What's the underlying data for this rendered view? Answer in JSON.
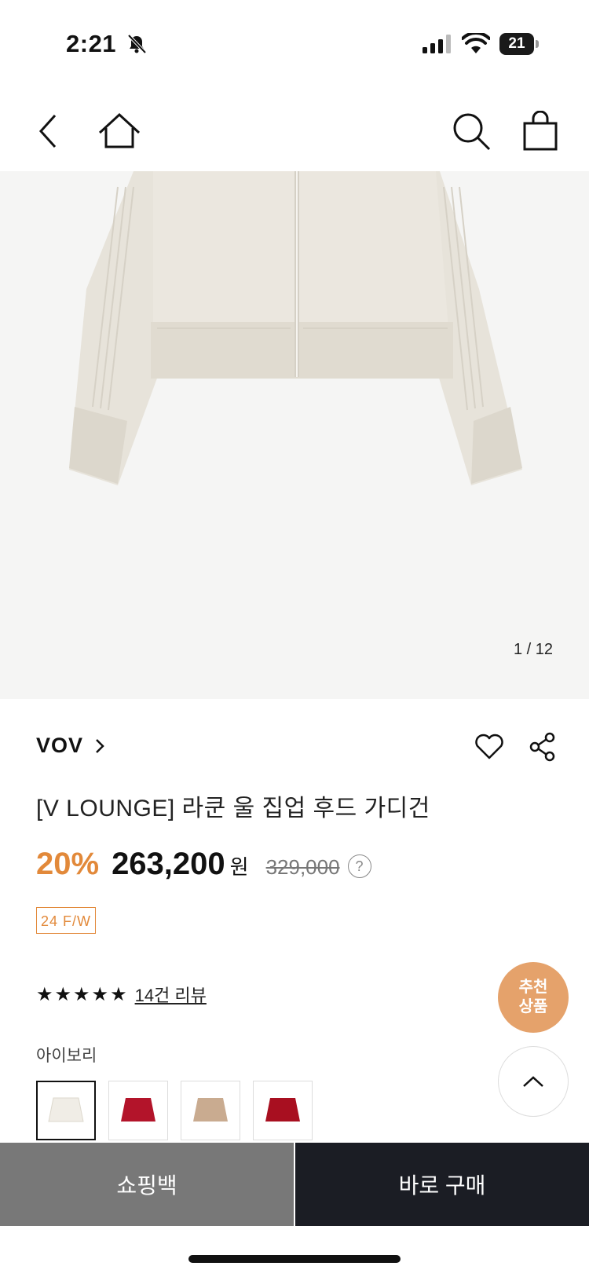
{
  "status_bar": {
    "time": "2:21",
    "battery": "21"
  },
  "nav": {
    "back_icon": "chevron-left-icon",
    "home_icon": "home-icon",
    "search_icon": "search-icon",
    "bag_icon": "shopping-bag-icon"
  },
  "gallery": {
    "counter": "1 / 12"
  },
  "product": {
    "brand": "VOV",
    "name": "[V LOUNGE] 라쿤 울 집업 후드 가디건",
    "discount": "20%",
    "price": "263,200",
    "currency": "원",
    "original_price": "329,000",
    "help": "?",
    "season_badge": "24 F/W",
    "stars": "★★★★★",
    "review_link": "14건 리뷰",
    "color_label": "아이보리",
    "swatches": [
      {
        "color": "#f0ede6",
        "name": "ivory"
      },
      {
        "color": "#b3142a",
        "name": "red"
      },
      {
        "color": "#c9ab90",
        "name": "beige"
      },
      {
        "color": "#a80f20",
        "name": "red-2"
      }
    ]
  },
  "floating": {
    "recommend_line1": "추천",
    "recommend_line2": "상품"
  },
  "bottom_bar": {
    "bag_label": "쇼핑백",
    "buy_label": "바로 구매"
  },
  "colors": {
    "accent": "#e2893a",
    "recommend": "#e5a26b",
    "buy_bg": "#1b1d24",
    "bag_bg": "#787878"
  }
}
